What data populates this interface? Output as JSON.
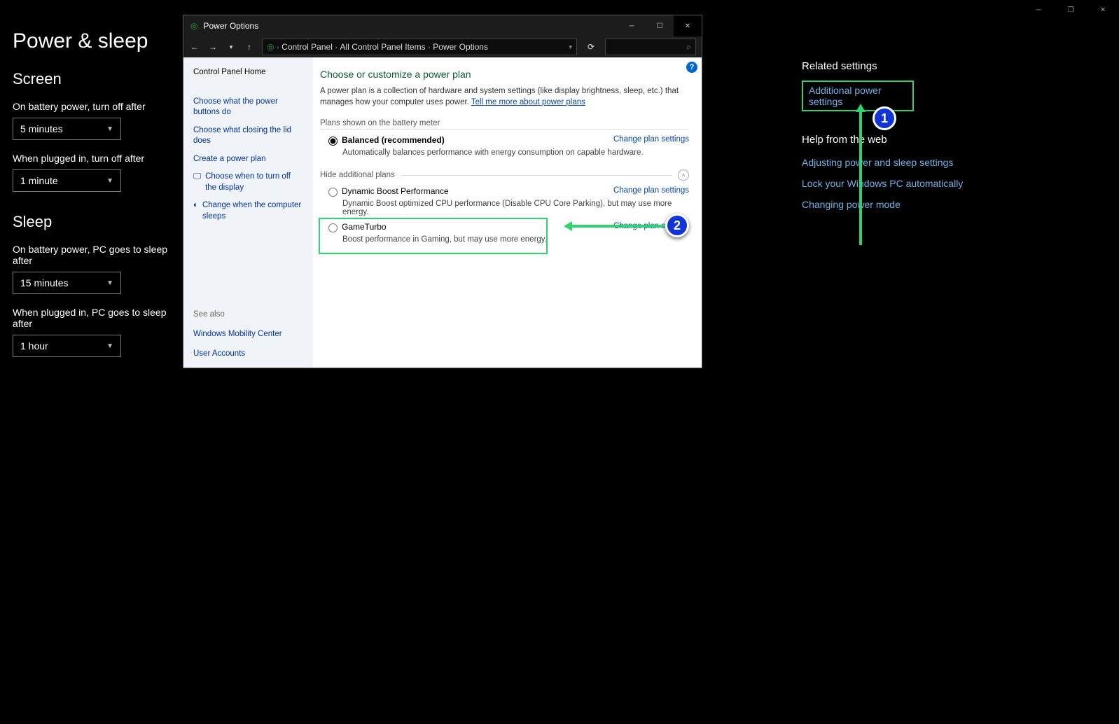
{
  "appChrome": {
    "min": "─",
    "max": "❐",
    "close": "✕"
  },
  "settings": {
    "title": "Power & sleep",
    "screen": {
      "heading": "Screen",
      "batteryLabel": "On battery power, turn off after",
      "batteryValue": "5 minutes",
      "pluggedLabel": "When plugged in, turn off after",
      "pluggedValue": "1 minute"
    },
    "sleep": {
      "heading": "Sleep",
      "batteryLabel": "On battery power, PC goes to sleep after",
      "batteryValue": "15 minutes",
      "pluggedLabel": "When plugged in, PC goes to sleep after",
      "pluggedValue": "1 hour"
    }
  },
  "related": {
    "heading": "Related settings",
    "additional": "Additional power settings",
    "webHeading": "Help from the web",
    "links": {
      "a": "Adjusting power and sleep settings",
      "b": "Lock your Windows PC automatically",
      "c": "Changing power mode"
    }
  },
  "cp": {
    "title": "Power Options",
    "crumbs": {
      "a": "Control Panel",
      "b": "All Control Panel Items",
      "c": "Power Options"
    },
    "left": {
      "home": "Control Panel Home",
      "l1": "Choose what the power buttons do",
      "l2": "Choose what closing the lid does",
      "l3": "Create a power plan",
      "l4": "Choose when to turn off the display",
      "l5": "Change when the computer sleeps",
      "seeAlso": "See also",
      "sa1": "Windows Mobility Center",
      "sa2": "User Accounts"
    },
    "main": {
      "heading": "Choose or customize a power plan",
      "desc1": "A power plan is a collection of hardware and system settings (like display brightness, sleep, etc.) that manages how your computer uses power. ",
      "descLink": "Tell me more about power plans",
      "plansShown": "Plans shown on the battery meter",
      "hide": "Hide additional plans",
      "change": "Change plan settings",
      "plan1": {
        "name": "Balanced (recommended)",
        "desc": "Automatically balances performance with energy consumption on capable hardware."
      },
      "plan2": {
        "name": "Dynamic Boost Performance",
        "desc": "Dynamic Boost optimized CPU performance (Disable CPU Core Parking), but may use more energy."
      },
      "plan3": {
        "name": "GameTurbo",
        "desc": "Boost performance in Gaming, but may use more energy."
      }
    }
  },
  "badges": {
    "one": "1",
    "two": "2"
  }
}
